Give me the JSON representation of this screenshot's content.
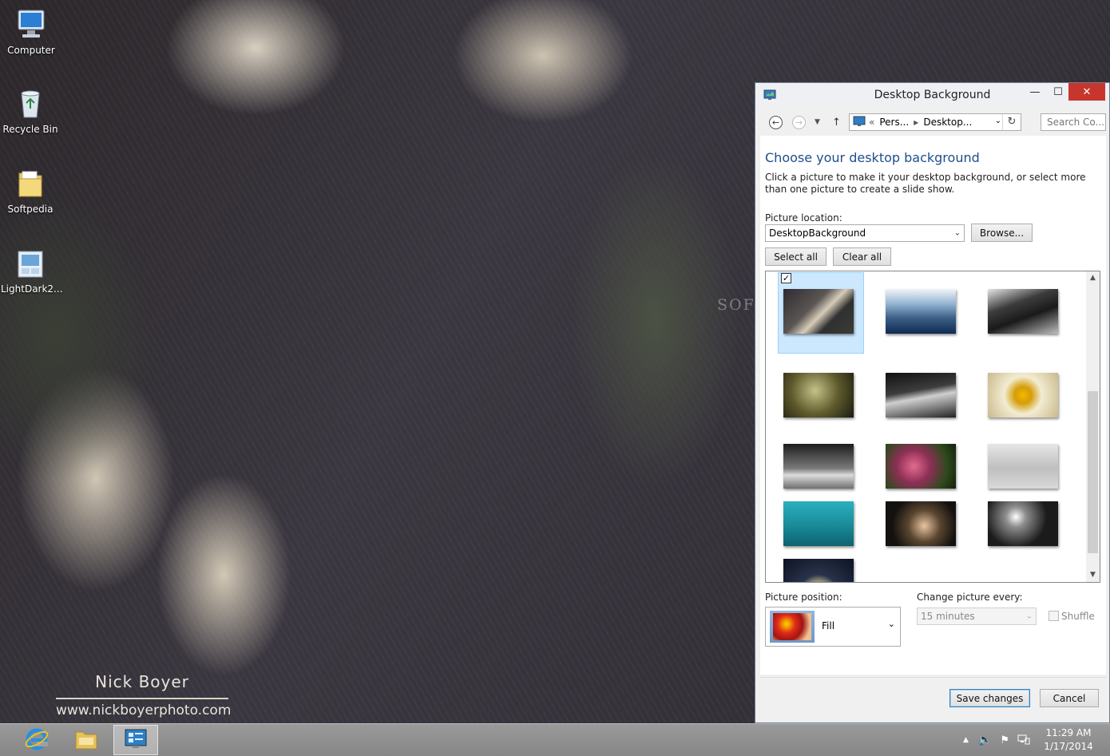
{
  "desktop": {
    "icons": [
      {
        "label": "Computer"
      },
      {
        "label": "Recycle Bin"
      },
      {
        "label": "Softpedia"
      },
      {
        "label": "LightDark2..."
      }
    ],
    "photographer_name": "Nick Boyer",
    "photographer_url": "www.nickboyerphoto.com",
    "watermark": "SOFTPEDIA"
  },
  "window": {
    "title": "Desktop Background",
    "controls": {
      "minimize": "—",
      "maximize": "☐",
      "close": "✕"
    },
    "nav": {
      "back": "←",
      "forward": "→",
      "up": "↑",
      "refresh": "↻",
      "breadcrumb_prefix": "«",
      "breadcrumb": [
        "Pers...",
        "Desktop..."
      ],
      "search_placeholder": "Search Co..."
    },
    "heading": "Choose your desktop background",
    "description": "Click a picture to make it your desktop background, or select more than one picture to create a slide show.",
    "picture_location_label": "Picture location:",
    "picture_location_value": "DesktopBackground",
    "browse_label": "Browse...",
    "select_all_label": "Select all",
    "clear_all_label": "Clear all",
    "selected_check": "✓",
    "picture_position_label": "Picture position:",
    "picture_position_value": "Fill",
    "change_every_label": "Change picture every:",
    "change_every_value": "15 minutes",
    "shuffle_label": "Shuffle",
    "shuffle_checked": false,
    "save_label": "Save changes",
    "cancel_label": "Cancel"
  },
  "taskbar": {
    "time": "11:29 AM",
    "date": "1/17/2014"
  }
}
